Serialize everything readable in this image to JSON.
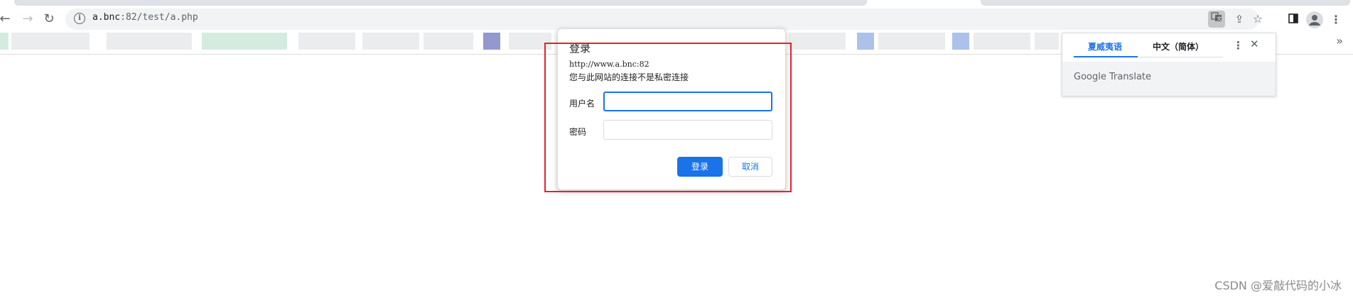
{
  "browser": {
    "omnibox": {
      "url_host": "a.bnc",
      "url_rest": ":82/test/a.php"
    },
    "icons": {
      "back": "arrow-left-icon",
      "forward": "arrow-right-icon",
      "reload": "reload-icon",
      "site_info": "info-icon",
      "translate": "translate-icon",
      "share": "share-icon",
      "bookmark": "star-icon",
      "side_panel": "side-panel-icon",
      "profile": "avatar-icon",
      "menu": "kebab-menu-icon",
      "bookmarks_overflow": "chevron-double-right-icon"
    }
  },
  "dialog": {
    "title": "登录",
    "site": "http://www.a.bnc:82",
    "warning": "您与此网站的连接不是私密连接",
    "username_label": "用户名",
    "username_value": "",
    "password_label": "密码",
    "password_value": "",
    "login_button": "登录",
    "cancel_button": "取消"
  },
  "translate_popup": {
    "tab_source": "夏威夷语",
    "tab_target": "中文（简体）",
    "brand": "Google Translate"
  },
  "watermark": "CSDN @爱敲代码的小冰",
  "colors": {
    "accent": "#1a73e8",
    "highlight_box": "#e5212f"
  }
}
